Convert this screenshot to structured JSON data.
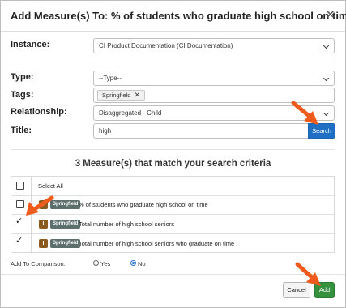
{
  "dialog": {
    "title": "Add Measure(s) To: % of students who graduate high school on time",
    "close_icon": "close-icon"
  },
  "form": {
    "instance_label": "Instance:",
    "instance_value": "CI Product Documentation (CI Documentation)",
    "type_label": "Type:",
    "type_value": "--Type--",
    "tags_label": "Tags:",
    "tags": [
      {
        "label": "Springfield",
        "remove_icon": "✕"
      }
    ],
    "relationship_label": "Relationship:",
    "relationship_value": "Disaggregated - Child",
    "title_label": "Title:",
    "title_value": "high",
    "search_label": "Search"
  },
  "results": {
    "heading": "3 Measure(s) that match your search criteria",
    "select_all_label": "Select All",
    "rows": [
      {
        "checked": false,
        "icon": "I",
        "badge": "Springfield",
        "text": "% of students who graduate high school on time"
      },
      {
        "checked": true,
        "icon": "I",
        "badge": "Springfield",
        "text": "Total number of high school seniors"
      },
      {
        "checked": true,
        "icon": "I",
        "badge": "Springfield",
        "text": "Total number of high school seniors who graduate on time"
      }
    ]
  },
  "comparison": {
    "label": "Add To Comparison:",
    "yes_label": "Yes",
    "no_label": "No",
    "selected": "No"
  },
  "footer": {
    "cancel_label": "Cancel",
    "add_label": "Add"
  },
  "colors": {
    "search_button": "#1f6fc4",
    "add_button": "#35913e",
    "annotation_arrow": "#f05a1a",
    "indicator_badge": "#8a5a1e",
    "location_badge": "#5c6f6d"
  }
}
